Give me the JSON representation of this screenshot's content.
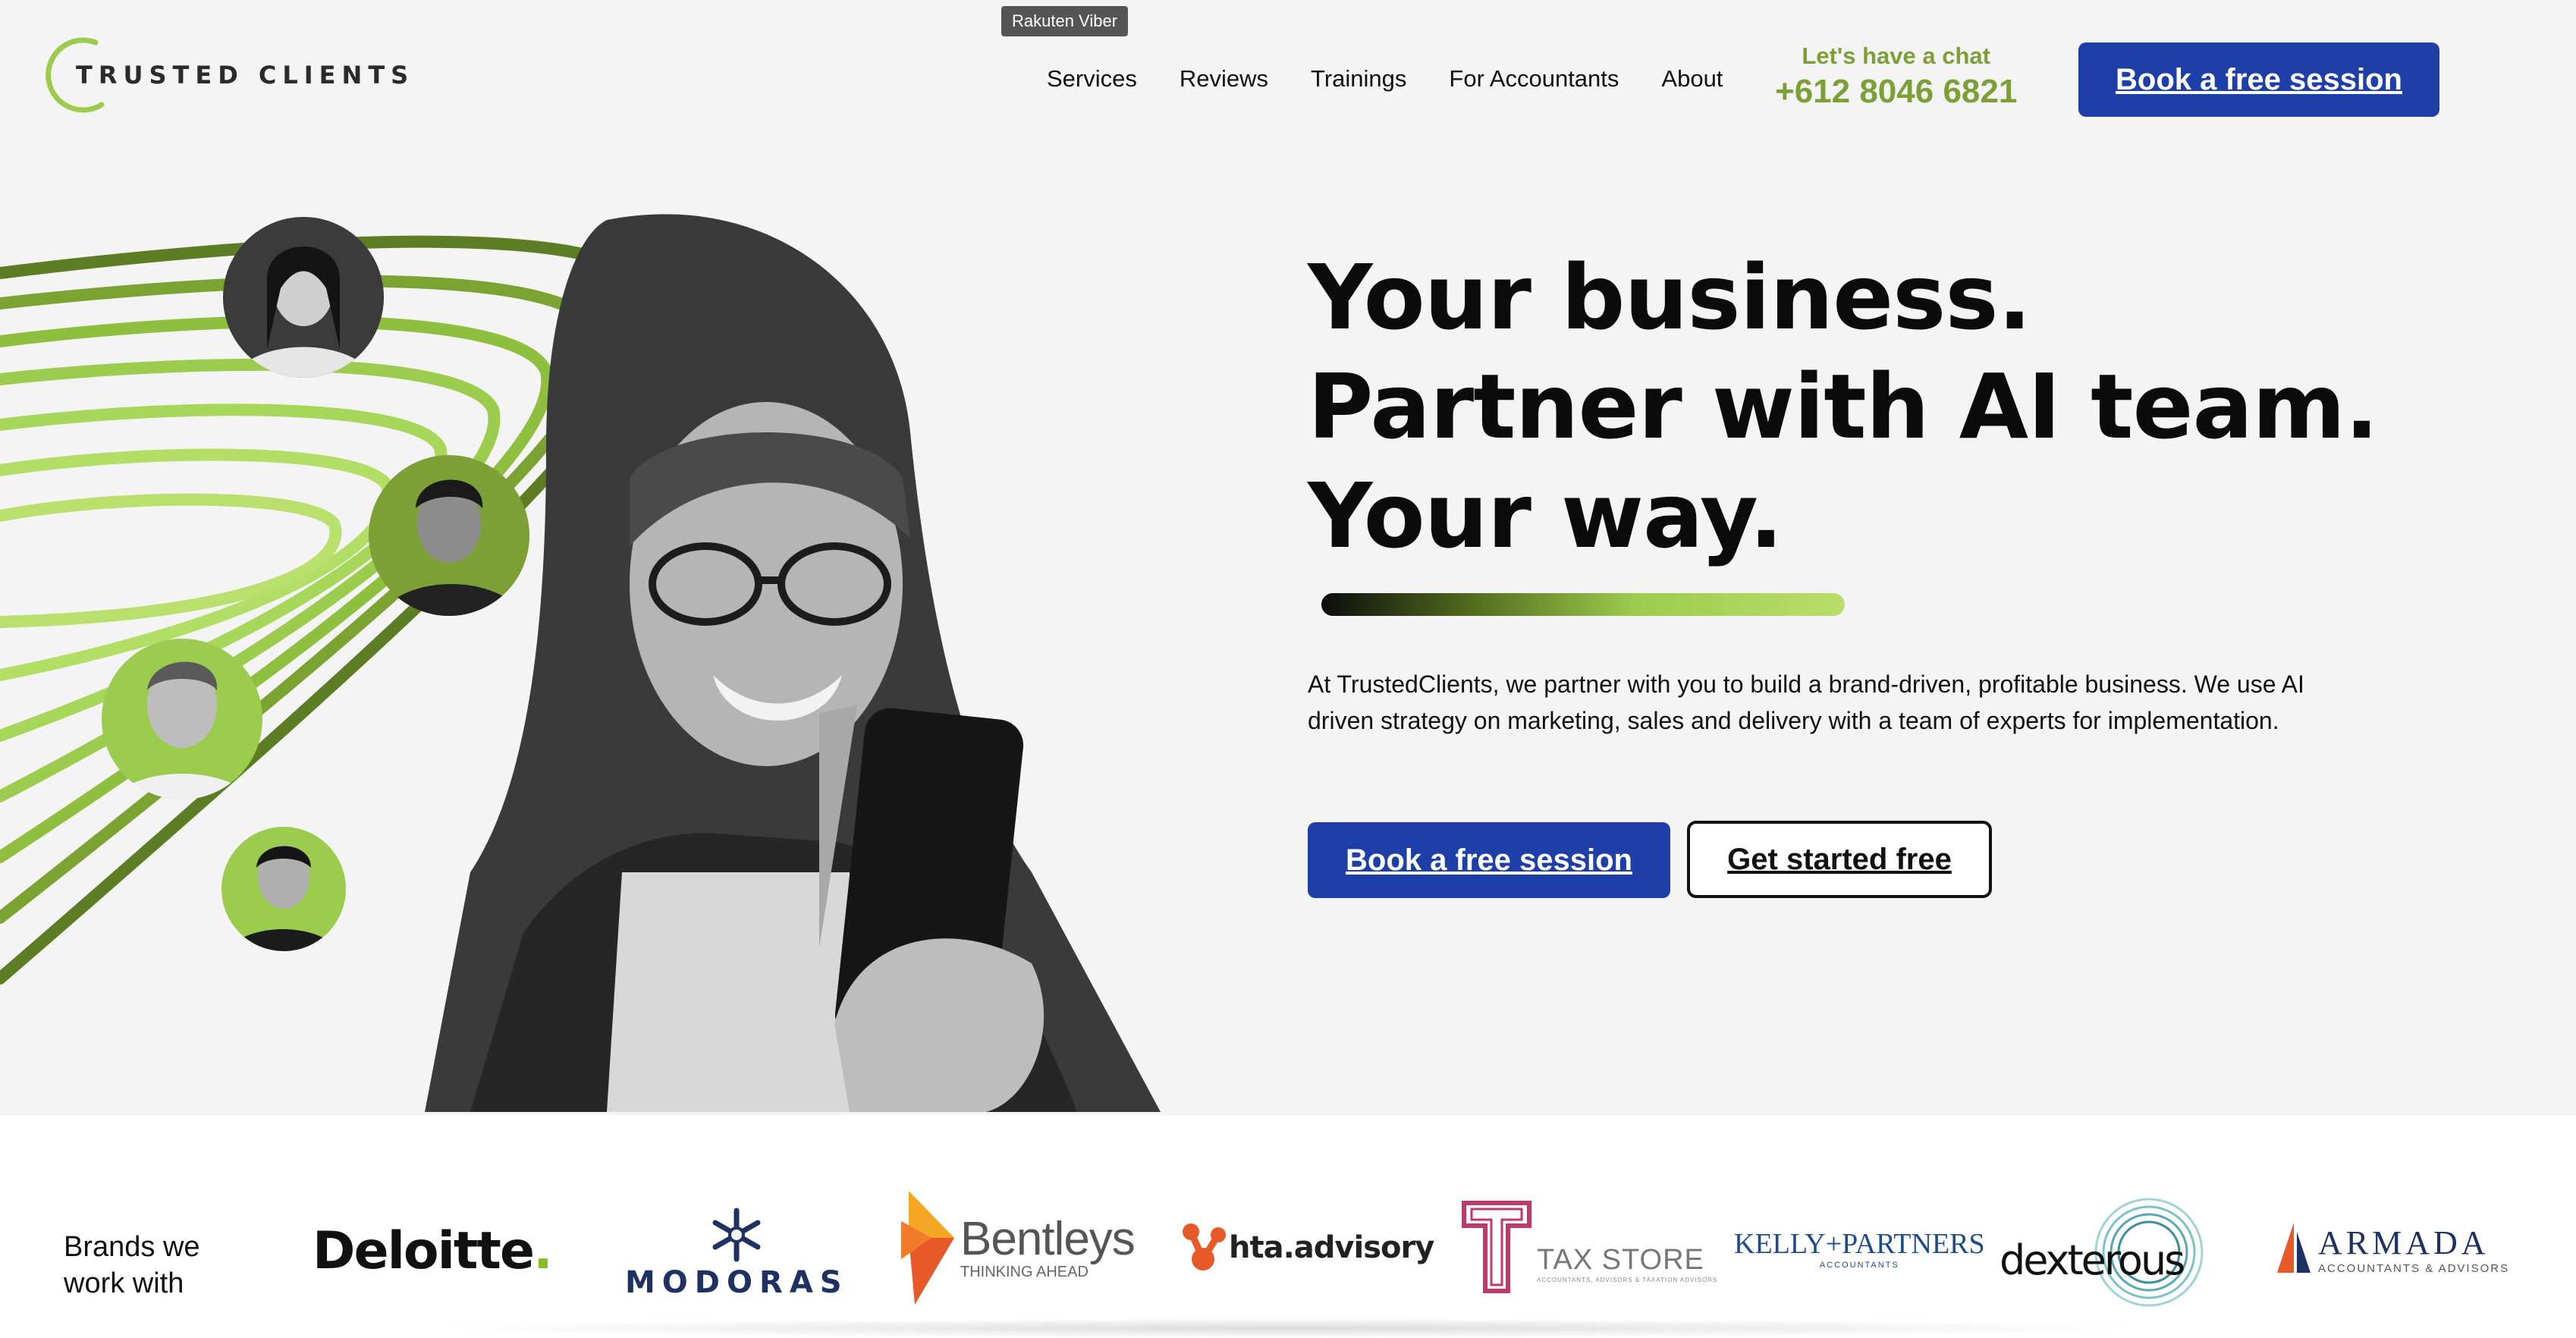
{
  "tooltip": "Rakuten Viber",
  "logo": {
    "text": "TRUSTED CLIENTS",
    "icon": "ring-logo-icon"
  },
  "nav": {
    "items": [
      {
        "label": "Services"
      },
      {
        "label": "Reviews"
      },
      {
        "label": "Trainings"
      },
      {
        "label": "For Accountants"
      },
      {
        "label": "About"
      }
    ]
  },
  "chat": {
    "label": "Let's have a chat",
    "phone": "+612 8046 6821"
  },
  "header_cta": "Book a free session",
  "hero": {
    "headline": [
      "Your business.",
      "Partner with AI team.",
      "Your way."
    ],
    "description": "At TrustedClients, we partner with you to build a brand-driven, profitable business. We use AI driven strategy on marketing, sales and delivery with a team of experts for implementation.",
    "primary_cta": "Book a free session",
    "secondary_cta": "Get started free"
  },
  "brands": {
    "label_line1": "Brands we",
    "label_line2": "work with",
    "logos": [
      {
        "name": "Deloitte",
        "text": "Deloitte",
        "dot": "."
      },
      {
        "name": "Modoras",
        "text": "MODORAS"
      },
      {
        "name": "Bentleys",
        "text": "Bentleys",
        "tagline": "THINKING AHEAD"
      },
      {
        "name": "hta.advisory",
        "text": "hta.advisory"
      },
      {
        "name": "Tax Store",
        "text": "TAX STORE",
        "tagline": "ACCOUNTANTS, ADVISORS & TAXATION ADVISORS"
      },
      {
        "name": "Kelly+Partners",
        "text": "KELLY+PARTNERS",
        "tagline": "ACCOUNTANTS"
      },
      {
        "name": "dexterous",
        "text": "dexterous"
      },
      {
        "name": "Armada",
        "text": "ARMADA",
        "tagline": "ACCOUNTANTS & ADVISORS"
      }
    ]
  },
  "colors": {
    "brand_blue": "#1f3fa8",
    "accent_green": "#7da036",
    "light_green": "#b9de6a",
    "deloitte_green": "#86bc25",
    "hta_orange": "#e8592a",
    "taxstore_pink": "#c0396b",
    "kelly_blue": "#1f4a8c"
  }
}
